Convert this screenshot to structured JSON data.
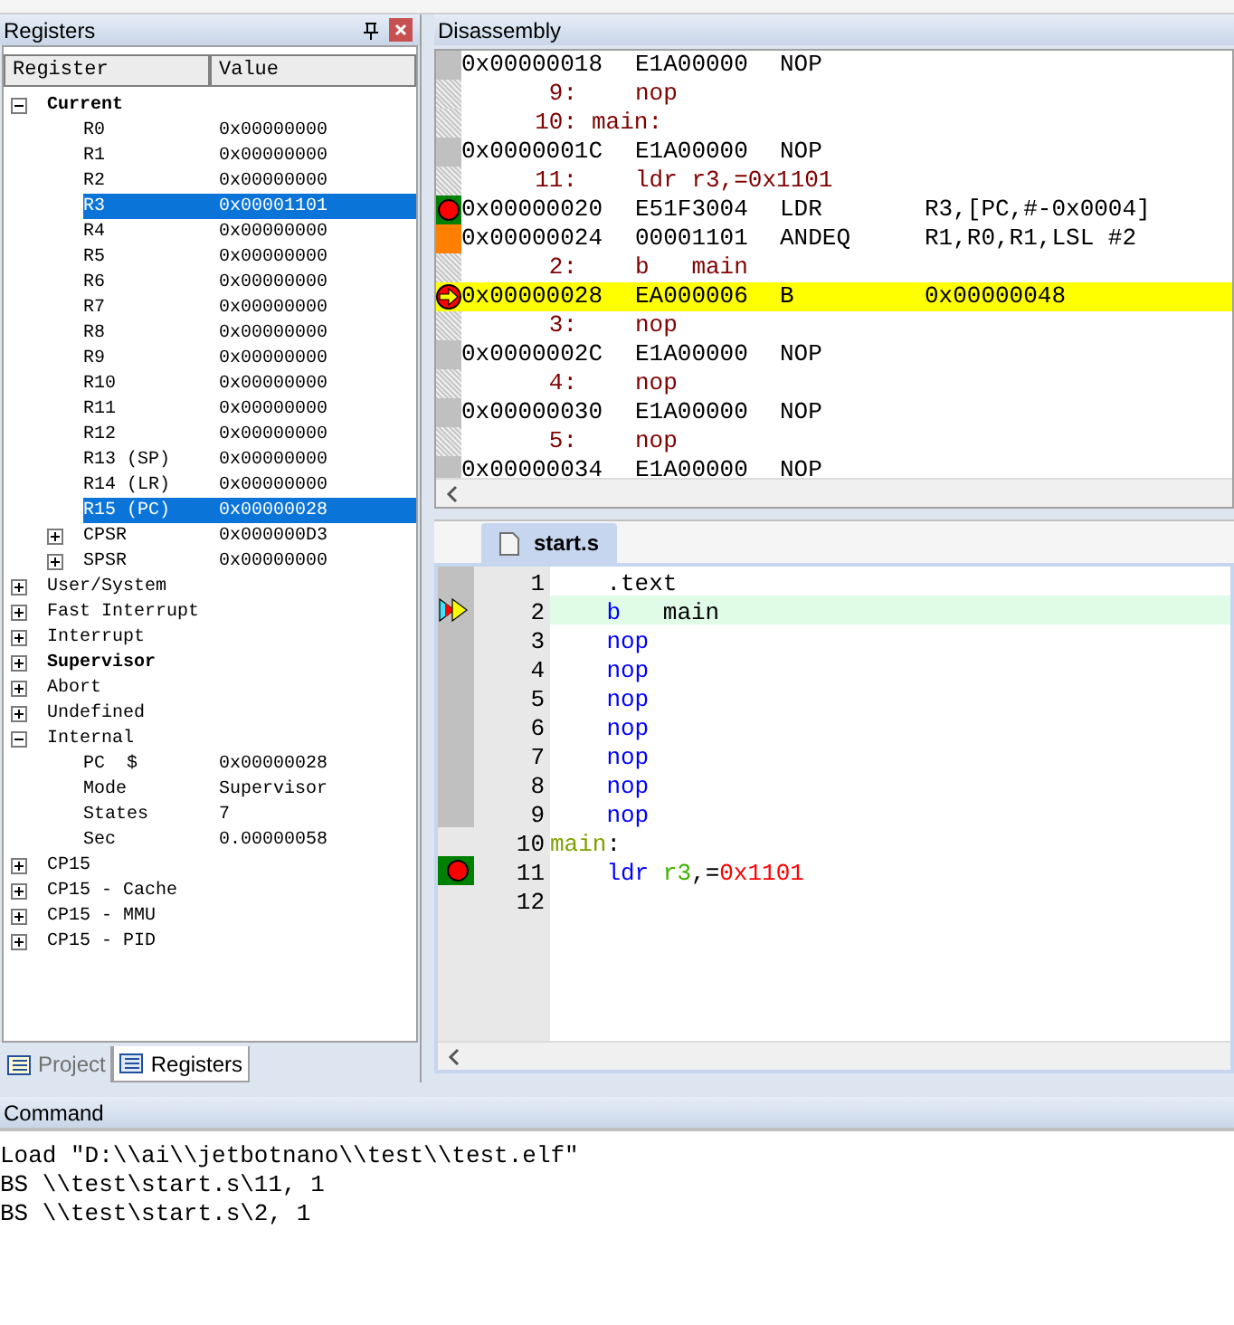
{
  "registers_panel": {
    "title": "Registers",
    "columns": [
      "Register",
      "Value"
    ],
    "tree": [
      {
        "label": "Current",
        "bold": true,
        "expanded": true,
        "selected": false,
        "children": [
          {
            "label": "R0",
            "value": "0x00000000",
            "selected": false
          },
          {
            "label": "R1",
            "value": "0x00000000",
            "selected": false
          },
          {
            "label": "R2",
            "value": "0x00000000",
            "selected": false
          },
          {
            "label": "R3",
            "value": "0x00001101",
            "selected": true
          },
          {
            "label": "R4",
            "value": "0x00000000",
            "selected": false
          },
          {
            "label": "R5",
            "value": "0x00000000",
            "selected": false
          },
          {
            "label": "R6",
            "value": "0x00000000",
            "selected": false
          },
          {
            "label": "R7",
            "value": "0x00000000",
            "selected": false
          },
          {
            "label": "R8",
            "value": "0x00000000",
            "selected": false
          },
          {
            "label": "R9",
            "value": "0x00000000",
            "selected": false
          },
          {
            "label": "R10",
            "value": "0x00000000",
            "selected": false
          },
          {
            "label": "R11",
            "value": "0x00000000",
            "selected": false
          },
          {
            "label": "R12",
            "value": "0x00000000",
            "selected": false
          },
          {
            "label": "R13 (SP)",
            "value": "0x00000000",
            "selected": false
          },
          {
            "label": "R14 (LR)",
            "value": "0x00000000",
            "selected": false
          },
          {
            "label": "R15 (PC)",
            "value": "0x00000028",
            "selected": true
          },
          {
            "label": "CPSR",
            "value": "0x000000D3",
            "selected": false,
            "expanded": false
          },
          {
            "label": "SPSR",
            "value": "0x00000000",
            "selected": false,
            "expanded": false
          }
        ]
      },
      {
        "label": "User/System",
        "selected": false,
        "expanded": false
      },
      {
        "label": "Fast Interrupt",
        "selected": false,
        "expanded": false
      },
      {
        "label": "Interrupt",
        "selected": false,
        "expanded": false
      },
      {
        "label": "Supervisor",
        "bold": true,
        "selected": false,
        "expanded": false
      },
      {
        "label": "Abort",
        "selected": false,
        "expanded": false
      },
      {
        "label": "Undefined",
        "selected": false,
        "expanded": false
      },
      {
        "label": "Internal",
        "selected": false,
        "expanded": true,
        "children": [
          {
            "label": "PC  $",
            "value": "0x00000028",
            "selected": false
          },
          {
            "label": "Mode",
            "value": "Supervisor",
            "selected": false
          },
          {
            "label": "States",
            "value": "7",
            "selected": false
          },
          {
            "label": "Sec",
            "value": "0.00000058",
            "selected": false
          }
        ]
      },
      {
        "label": "CP15",
        "selected": false,
        "expanded": false
      },
      {
        "label": "CP15 - Cache",
        "selected": false,
        "expanded": false
      },
      {
        "label": "CP15 - MMU",
        "selected": false,
        "expanded": false
      },
      {
        "label": "CP15 - PID",
        "selected": false,
        "expanded": false
      }
    ],
    "tabs": [
      {
        "label": "Project",
        "selected": false
      },
      {
        "label": "Registers",
        "selected": true
      }
    ]
  },
  "disassembly": {
    "title": "Disassembly",
    "rows": [
      {
        "kind": "asm",
        "breakpoint": false,
        "executed": false,
        "current": false,
        "address": "0x00000018",
        "opcode": "E1A00000",
        "mnemonic": "NOP"
      },
      {
        "kind": "src",
        "breakpoint": false,
        "executed": false,
        "current": false,
        "line": "9:",
        "text": "nop"
      },
      {
        "kind": "src",
        "breakpoint": false,
        "executed": false,
        "current": false,
        "line": "10:",
        "text": "main:"
      },
      {
        "kind": "asm",
        "breakpoint": false,
        "executed": false,
        "current": false,
        "address": "0x0000001C",
        "opcode": "E1A00000",
        "mnemonic": "NOP"
      },
      {
        "kind": "src",
        "breakpoint": false,
        "executed": false,
        "current": false,
        "line": "11:",
        "text": "ldr r3,=0x1101"
      },
      {
        "kind": "asm",
        "breakpoint": true,
        "executed": false,
        "current": false,
        "address": "0x00000020",
        "opcode": "E51F3004",
        "mnemonic": "LDR",
        "operands": "R3,[PC,#-0x0004]"
      },
      {
        "kind": "asm",
        "breakpoint": false,
        "executed": true,
        "current": false,
        "address": "0x00000024",
        "opcode": "00001101",
        "mnemonic": "ANDEQ",
        "operands": "R1,R0,R1,LSL #2"
      },
      {
        "kind": "src",
        "breakpoint": false,
        "executed": false,
        "current": false,
        "line": "2:",
        "text": "b   main"
      },
      {
        "kind": "asm",
        "breakpoint": false,
        "executed": false,
        "current": true,
        "address": "0x00000028",
        "opcode": "EA000006",
        "mnemonic": "B",
        "operands": "0x00000048"
      },
      {
        "kind": "src",
        "breakpoint": false,
        "executed": false,
        "current": false,
        "line": "3:",
        "text": "nop"
      },
      {
        "kind": "asm",
        "breakpoint": false,
        "executed": false,
        "current": false,
        "address": "0x0000002C",
        "opcode": "E1A00000",
        "mnemonic": "NOP"
      },
      {
        "kind": "src",
        "breakpoint": false,
        "executed": false,
        "current": false,
        "line": "4:",
        "text": "nop"
      },
      {
        "kind": "asm",
        "breakpoint": false,
        "executed": false,
        "current": false,
        "address": "0x00000030",
        "opcode": "E1A00000",
        "mnemonic": "NOP"
      },
      {
        "kind": "src",
        "breakpoint": false,
        "executed": false,
        "current": false,
        "line": "5:",
        "text": "nop"
      },
      {
        "kind": "asm",
        "breakpoint": false,
        "executed": false,
        "current": false,
        "address": "0x00000034",
        "opcode": "E1A00000",
        "mnemonic": "NOP"
      }
    ]
  },
  "editor": {
    "tab": {
      "label": "start.s",
      "selected": true
    },
    "lines": [
      {
        "number": "1",
        "breakpoint": false,
        "current": false,
        "shaded": true,
        "highlighted": false,
        "instruction": {
          "kind": "plain",
          "text": ".text"
        }
      },
      {
        "number": "2",
        "breakpoint": false,
        "current": true,
        "shaded": true,
        "highlighted": true,
        "instruction": {
          "kind": "keyword",
          "text": "b"
        },
        "operands": [
          {
            "kind": "plain",
            "text": "main"
          }
        ]
      },
      {
        "number": "3",
        "breakpoint": false,
        "current": false,
        "shaded": true,
        "highlighted": false,
        "instruction": {
          "kind": "keyword",
          "text": "nop"
        }
      },
      {
        "number": "4",
        "breakpoint": false,
        "current": false,
        "shaded": true,
        "highlighted": false,
        "instruction": {
          "kind": "keyword",
          "text": "nop"
        }
      },
      {
        "number": "5",
        "breakpoint": false,
        "current": false,
        "shaded": true,
        "highlighted": false,
        "instruction": {
          "kind": "keyword",
          "text": "nop"
        }
      },
      {
        "number": "6",
        "breakpoint": false,
        "current": false,
        "shaded": true,
        "highlighted": false,
        "instruction": {
          "kind": "keyword",
          "text": "nop"
        }
      },
      {
        "number": "7",
        "breakpoint": false,
        "current": false,
        "shaded": true,
        "highlighted": false,
        "instruction": {
          "kind": "keyword",
          "text": "nop"
        }
      },
      {
        "number": "8",
        "breakpoint": false,
        "current": false,
        "shaded": true,
        "highlighted": false,
        "instruction": {
          "kind": "keyword",
          "text": "nop"
        }
      },
      {
        "number": "9",
        "breakpoint": false,
        "current": false,
        "shaded": true,
        "highlighted": false,
        "instruction": {
          "kind": "keyword",
          "text": "nop"
        }
      },
      {
        "number": "10",
        "breakpoint": false,
        "current": false,
        "shaded": false,
        "highlighted": false,
        "label": [
          {
            "kind": "label",
            "text": "main"
          },
          {
            "kind": "plain",
            "text": ":"
          }
        ]
      },
      {
        "number": "11",
        "breakpoint": true,
        "current": false,
        "shaded": false,
        "highlighted": false,
        "instruction": {
          "kind": "keyword",
          "text": "ldr"
        },
        "operands": [
          {
            "kind": "register",
            "text": "r3"
          },
          {
            "kind": "plain",
            "text": ",="
          },
          {
            "kind": "number",
            "text": "0x1101"
          }
        ]
      },
      {
        "number": "12",
        "breakpoint": false,
        "current": false,
        "shaded": false,
        "highlighted": false
      }
    ]
  },
  "command": {
    "title": "Command",
    "lines": [
      "Load \"D:\\\\ai\\\\jetbotnano\\\\test\\\\test.elf\"",
      "BS \\\\test\\start.s\\11, 1",
      "BS \\\\test\\start.s\\2, 1"
    ]
  }
}
